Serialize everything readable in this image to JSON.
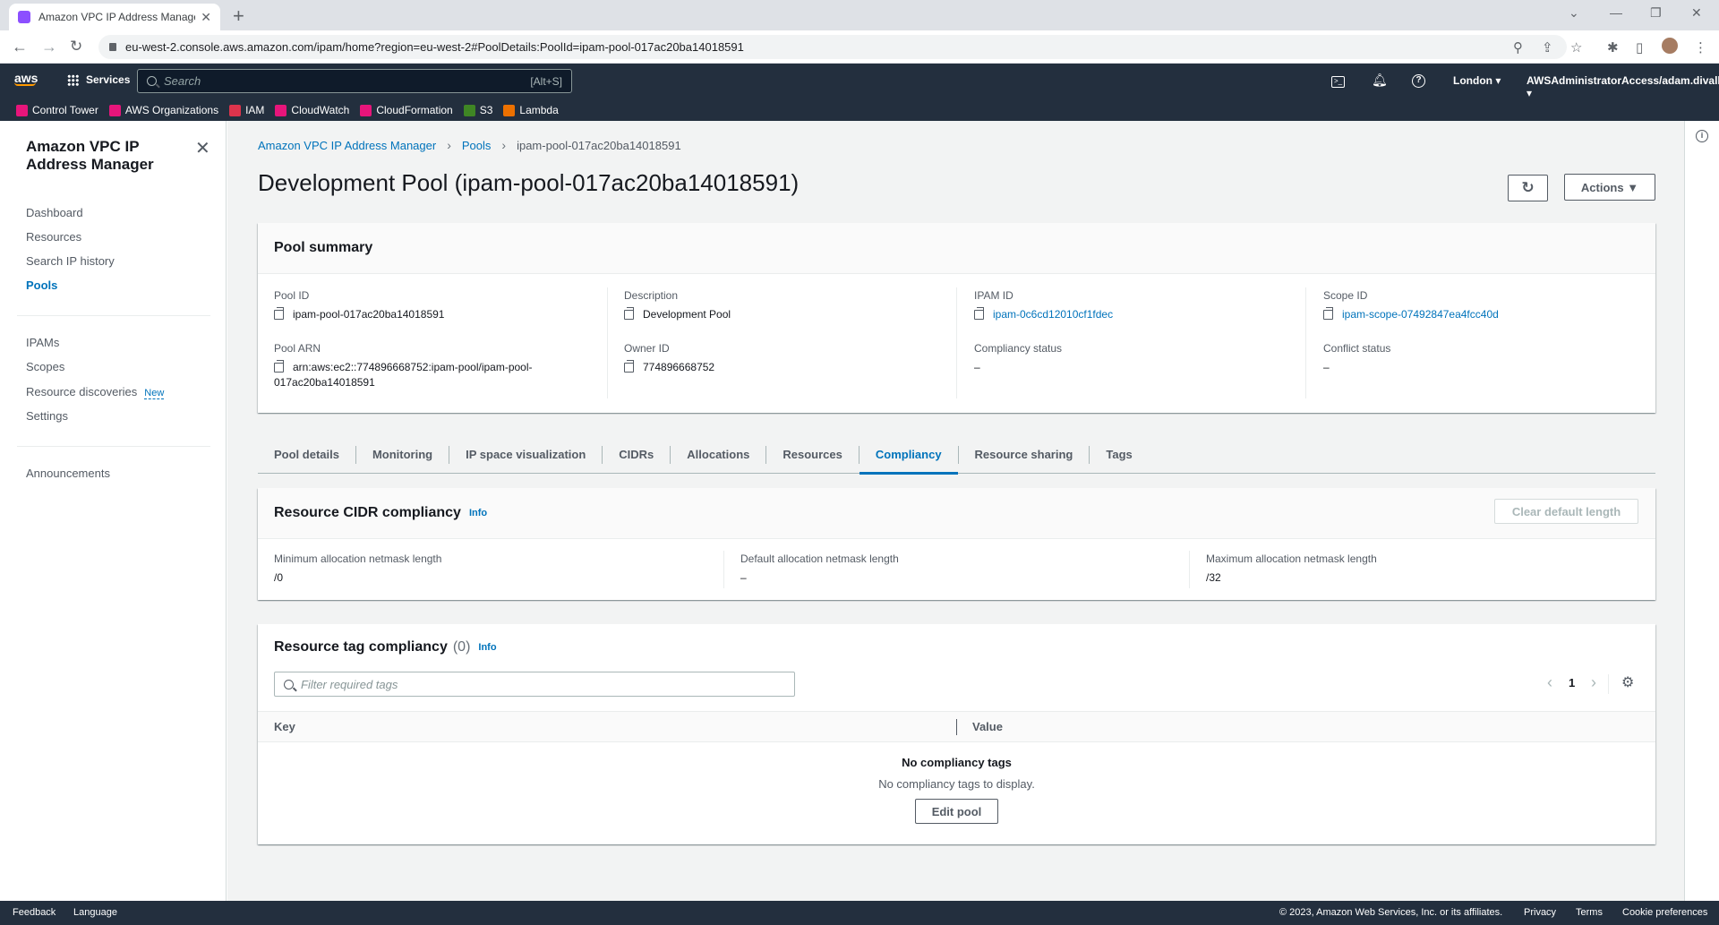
{
  "browser": {
    "tab_title": "Amazon VPC IP Address Manage",
    "url": "eu-west-2.console.aws.amazon.com/ipam/home?region=eu-west-2#PoolDetails:PoolId=ipam-pool-017ac20ba14018591"
  },
  "aws_header": {
    "logo": "aws",
    "services": "Services",
    "search_placeholder": "Search",
    "search_shortcut": "[Alt+S]",
    "region": "London ▾",
    "account": "AWSAdministratorAccess/adam.divall ▾"
  },
  "favorites": [
    {
      "label": "Control Tower",
      "color": "#e7157b"
    },
    {
      "label": "AWS Organizations",
      "color": "#e7157b"
    },
    {
      "label": "IAM",
      "color": "#dd344c"
    },
    {
      "label": "CloudWatch",
      "color": "#e7157b"
    },
    {
      "label": "CloudFormation",
      "color": "#e7157b"
    },
    {
      "label": "S3",
      "color": "#3f8624"
    },
    {
      "label": "Lambda",
      "color": "#ed7100"
    }
  ],
  "sidenav": {
    "title": "Amazon VPC IP Address Manager",
    "items_group1": [
      "Dashboard",
      "Resources",
      "Search IP history",
      "Pools"
    ],
    "items_group2": [
      "IPAMs",
      "Scopes",
      "Resource discoveries",
      "Settings"
    ],
    "new_badge": "New",
    "items_group3": [
      "Announcements"
    ]
  },
  "breadcrumb": {
    "root": "Amazon VPC IP Address Manager",
    "pools": "Pools",
    "current": "ipam-pool-017ac20ba14018591"
  },
  "page_title": "Development Pool (ipam-pool-017ac20ba14018591)",
  "actions_label": "Actions ▼",
  "summary": {
    "heading": "Pool summary",
    "pool_id_label": "Pool ID",
    "pool_id": "ipam-pool-017ac20ba14018591",
    "pool_arn_label": "Pool ARN",
    "pool_arn_line1": "arn:aws:ec2::774896668752:ipam-pool/ipam-pool-",
    "pool_arn_line2": "017ac20ba14018591",
    "description_label": "Description",
    "description": "Development Pool",
    "owner_id_label": "Owner ID",
    "owner_id": "774896668752",
    "ipam_id_label": "IPAM ID",
    "ipam_id": "ipam-0c6cd12010cf1fdec",
    "compliancy_label": "Compliancy status",
    "compliancy": "–",
    "scope_id_label": "Scope ID",
    "scope_id": "ipam-scope-07492847ea4fcc40d",
    "conflict_label": "Conflict status",
    "conflict": "–"
  },
  "tabs": [
    "Pool details",
    "Monitoring",
    "IP space visualization",
    "CIDRs",
    "Allocations",
    "Resources",
    "Compliancy",
    "Resource sharing",
    "Tags"
  ],
  "cidr_compliancy": {
    "heading": "Resource CIDR compliancy",
    "info": "Info",
    "clear_button": "Clear default length",
    "min_label": "Minimum allocation netmask length",
    "min": "/0",
    "default_label": "Default allocation netmask length",
    "default": "–",
    "max_label": "Maximum allocation netmask length",
    "max": "/32"
  },
  "tag_compliancy": {
    "heading": "Resource tag compliancy",
    "count": "(0)",
    "info": "Info",
    "filter_placeholder": "Filter required tags",
    "page": "1",
    "col_key": "Key",
    "col_value": "Value",
    "empty_title": "No compliancy tags",
    "empty_desc": "No compliancy tags to display.",
    "edit_button": "Edit pool"
  },
  "footer": {
    "feedback": "Feedback",
    "language": "Language",
    "copyright": "© 2023, Amazon Web Services, Inc. or its affiliates.",
    "privacy": "Privacy",
    "terms": "Terms",
    "cookies": "Cookie preferences"
  }
}
